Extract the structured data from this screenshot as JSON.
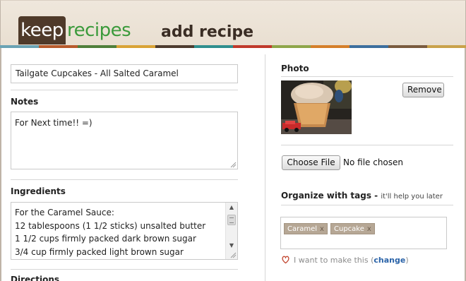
{
  "header": {
    "logo_keep": "keep",
    "logo_recipes": "recipes",
    "page_title": "add recipe",
    "stripe_colors": [
      "#6aa3b4",
      "#b85a2c",
      "#4f7f3a",
      "#d9a336",
      "#4d3b2e",
      "#2f8f8e",
      "#c0392b",
      "#8fa64a",
      "#d57f2a",
      "#3d6f9e",
      "#7a5b3e",
      "#c9a24b"
    ]
  },
  "form": {
    "recipe_title_value": "Tailgate Cupcakes - All Salted Caramel",
    "notes_label": "Notes",
    "notes_value": "For Next time!! =)",
    "ingredients_label": "Ingredients",
    "ingredients_lines": [
      "For the Caramel Sauce:",
      "12 tablespoons (1 1/2 sticks) unsalted butter",
      "1 1/2 cups firmly packed dark brown sugar",
      "3/4 cup firmly packed light brown sugar"
    ],
    "directions_label": "Directions"
  },
  "photo": {
    "label": "Photo",
    "remove_button": "Remove",
    "choose_file_button": "Choose File",
    "file_status": "No file chosen"
  },
  "tags": {
    "heading": "Organize with tags - ",
    "hint": "it'll help you later",
    "items": [
      {
        "label": "Caramel",
        "remove": "x"
      },
      {
        "label": "Cupcake",
        "remove": "x"
      }
    ]
  },
  "make": {
    "prefix": "I want to make this (",
    "change": "change",
    "suffix": ")"
  }
}
